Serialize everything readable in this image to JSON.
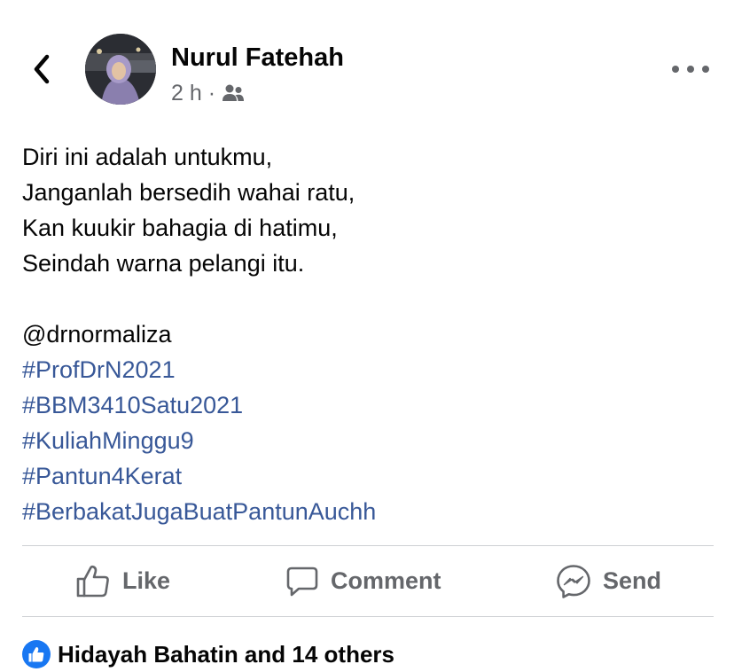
{
  "header": {
    "author_name": "Nurul Fatehah",
    "timestamp": "2 h",
    "separator": "·",
    "audience_icon": "friends-icon",
    "back_icon": "chevron-left-icon",
    "more_icon": "more-horizontal-icon"
  },
  "post": {
    "verse_lines": [
      "Diri ini adalah untukmu,",
      "Janganlah bersedih wahai ratu,",
      "Kan kuukir bahagia di hatimu,",
      "Seindah warna pelangi itu."
    ],
    "mention": "@drnormaliza",
    "hashtags": [
      "#ProfDrN2021",
      "#BBM3410Satu2021",
      "#KuliahMinggu9",
      "#Pantun4Kerat",
      "#BerbakatJugaBuatPantunAuchh"
    ]
  },
  "actions": {
    "like_label": "Like",
    "comment_label": "Comment",
    "send_label": "Send"
  },
  "reactions": {
    "summary": "Hidayah Bahatin and 14 others",
    "icon": "like-reaction-icon"
  },
  "colors": {
    "link": "#385898",
    "secondary_text": "#65676b",
    "primary_text": "#050505",
    "divider": "#ced0d4",
    "reaction_blue": "#1877f2"
  }
}
